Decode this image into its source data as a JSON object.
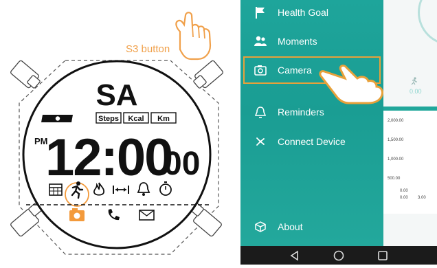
{
  "watch": {
    "s3_label": "S3 button",
    "day": "SA",
    "modes": [
      "Steps",
      "Kcal",
      "Km"
    ],
    "period": "PM",
    "time_main": "12:00",
    "time_seconds": "00",
    "icons": [
      "calendar-icon",
      "run-icon",
      "flame-icon",
      "distance-icon",
      "bell-icon",
      "stopwatch-icon",
      "camera-icon",
      "phone-icon",
      "envelope-icon"
    ],
    "accent_color": "#f39a3b"
  },
  "phone": {
    "menu": [
      {
        "label": "Health Goal",
        "icon": "flag-icon"
      },
      {
        "label": "Moments",
        "icon": "people-icon"
      },
      {
        "label": "Camera",
        "icon": "camera-icon"
      },
      {
        "label": "Reminders",
        "icon": "bell-icon"
      },
      {
        "label": "Connect Device",
        "icon": "bluetooth-icon"
      },
      {
        "label": "About",
        "icon": "cube-icon"
      }
    ],
    "stat_value": "0.00",
    "chart_y": [
      "2,000.00",
      "1,500.00",
      "1,000.00",
      "500.00",
      "0.00"
    ],
    "chart_x": [
      "0.00",
      "3.00"
    ],
    "drawer_color": "#1ea59b",
    "highlight_color": "#e8a13a"
  }
}
